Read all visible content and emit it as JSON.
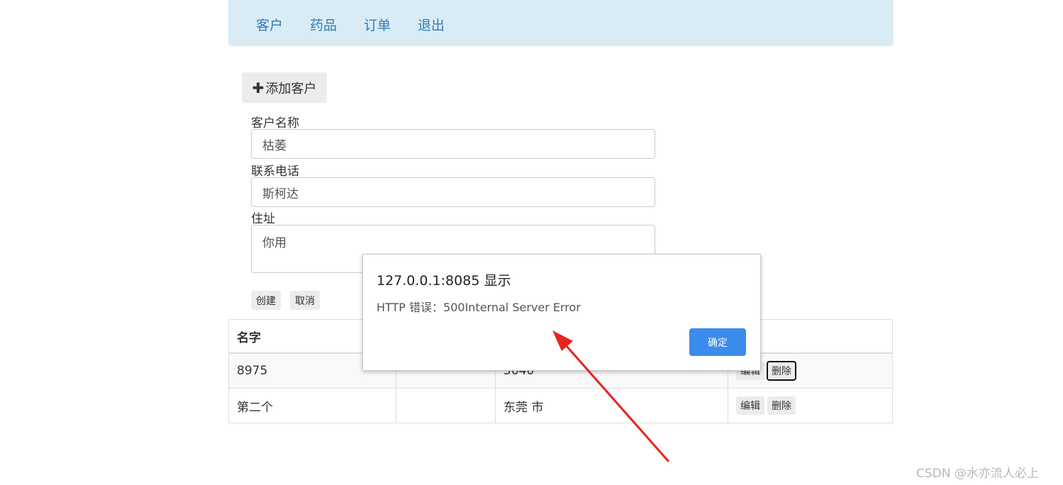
{
  "nav": {
    "items": [
      "客户",
      "药品",
      "订单",
      "退出"
    ]
  },
  "form": {
    "add_button_label": "添加客户",
    "add_icon": "plus-icon",
    "name_label": "客户名称",
    "name_value": "枯萎",
    "phone_label": "联系电话",
    "phone_value": "斯柯达",
    "address_label": "住址",
    "address_value": "你用",
    "create_label": "创建",
    "cancel_label": "取消"
  },
  "table": {
    "headers": [
      "名字",
      "",
      "",
      ""
    ],
    "rows": [
      {
        "name": "8975",
        "phone": "",
        "address": "5040",
        "edit": "编辑",
        "delete": "删除"
      },
      {
        "name": "第二个",
        "phone": "",
        "address": "东莞 市",
        "edit": "编辑",
        "delete": "删除"
      }
    ]
  },
  "dialog": {
    "title": "127.0.0.1:8085 显示",
    "message": "HTTP 错误：500Internal Server Error",
    "ok_label": "确定"
  },
  "annotation": {
    "arrow_color": "#e8231d"
  },
  "watermark": "CSDN @水亦流人必上",
  "colors": {
    "navbar_bg": "#d9ecf6",
    "nav_link": "#337ab7",
    "ok_button": "#3b8ced"
  }
}
